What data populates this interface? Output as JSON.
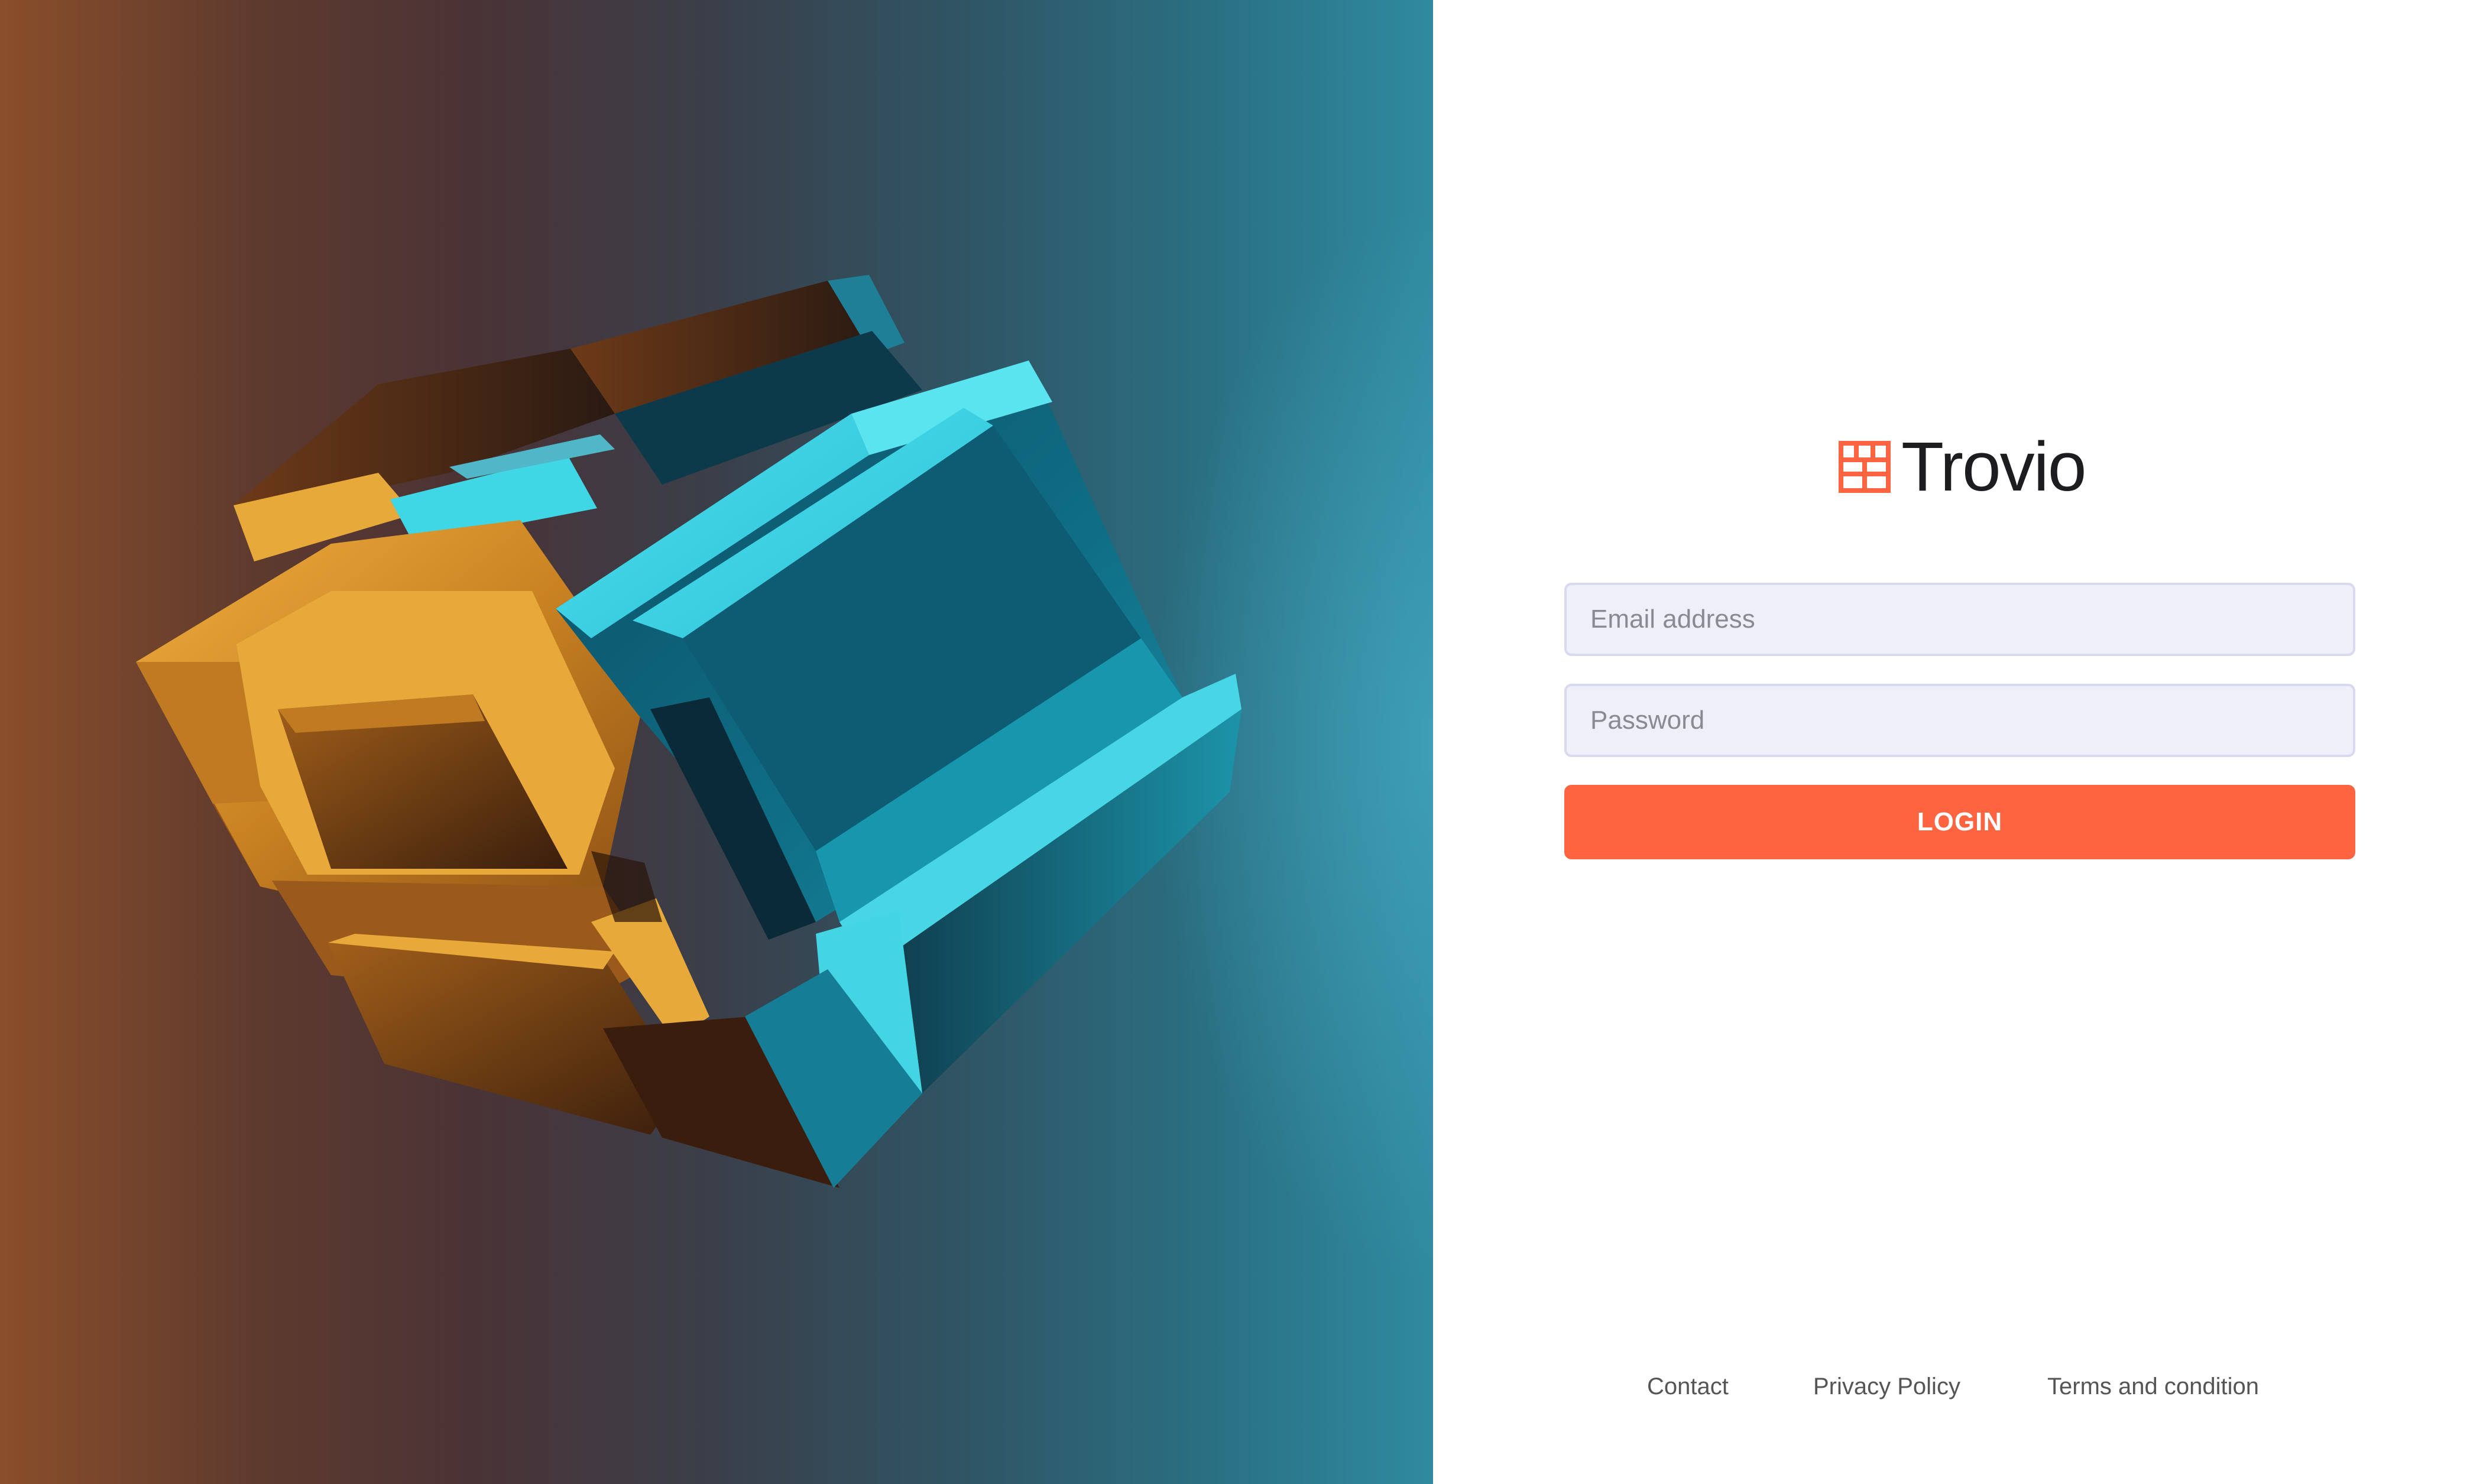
{
  "brand": {
    "name": "Trovio",
    "accent_color": "#ff6440",
    "logo_icon": "grid-logo-icon"
  },
  "hero": {
    "image_description": "3d-orange-and-cyan-cube-illustration"
  },
  "form": {
    "email_placeholder": "Email address",
    "password_placeholder": "Password",
    "email_value": "",
    "password_value": "",
    "login_label": "LOGIN"
  },
  "footer": {
    "links": [
      "Contact",
      "Privacy Policy",
      "Terms and condition"
    ]
  },
  "colors": {
    "field_background": "#efeff9",
    "field_border": "#d9d9ef",
    "button_background": "#ff6440",
    "text_dark": "#1d1d1f",
    "footer_text": "#555555"
  }
}
